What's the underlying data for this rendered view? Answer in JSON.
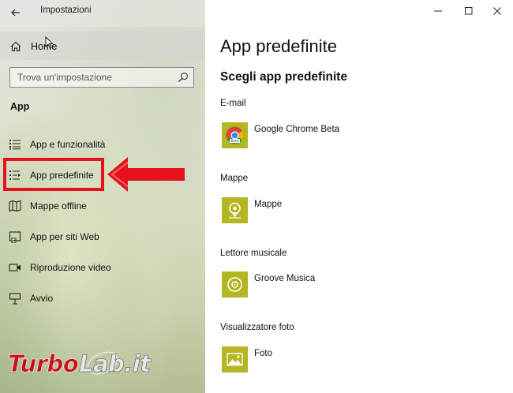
{
  "window": {
    "title": "Impostazioni",
    "controls": {
      "minimize": "minimize",
      "maximize": "maximize",
      "close": "close"
    }
  },
  "sidebar": {
    "home_label": "Home",
    "search_placeholder": "Trova un'impostazione",
    "section_heading": "App",
    "items": [
      {
        "label": "App e funzionalità",
        "icon": "list-icon"
      },
      {
        "label": "App predefinite",
        "icon": "default-apps-icon",
        "selected": true
      },
      {
        "label": "Mappe offline",
        "icon": "map-icon"
      },
      {
        "label": "App per siti Web",
        "icon": "web-app-icon"
      },
      {
        "label": "Riproduzione video",
        "icon": "video-icon"
      },
      {
        "label": "Avvio",
        "icon": "startup-icon"
      }
    ]
  },
  "annotation": {
    "color": "#e6121b"
  },
  "watermark": {
    "part1": "Turbo",
    "part2": "Lab.it"
  },
  "main": {
    "title": "App predefinite",
    "subtitle": "Scegli app predefinite",
    "categories": [
      {
        "label": "E-mail",
        "app": "Google Chrome Beta",
        "icon": "chrome-beta-icon"
      },
      {
        "label": "Mappe",
        "app": "Mappe",
        "icon": "maps-app-icon"
      },
      {
        "label": "Lettore musicale",
        "app": "Groove Musica",
        "icon": "groove-icon"
      },
      {
        "label": "Visualizzatore foto",
        "app": "Foto",
        "icon": "photos-icon"
      }
    ],
    "tile_color": "#b4b624"
  }
}
